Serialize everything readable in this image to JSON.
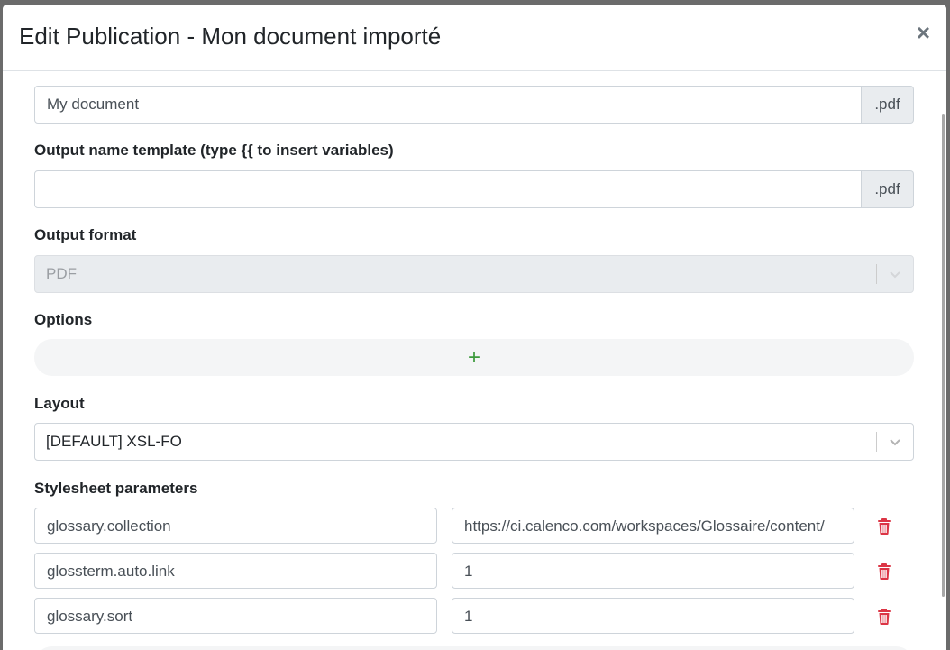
{
  "modal": {
    "title": "Edit Publication - Mon document importé",
    "close_label": "×"
  },
  "form": {
    "name_field": {
      "value": "My document",
      "suffix": ".pdf"
    },
    "output_template": {
      "label": "Output name template (type {{ to insert variables)",
      "value": "",
      "suffix": ".pdf"
    },
    "output_format": {
      "label": "Output format",
      "value": "PDF"
    },
    "options": {
      "label": "Options",
      "add_label": "+"
    },
    "layout": {
      "label": "Layout",
      "value": "[DEFAULT] XSL-FO"
    },
    "stylesheet_parameters": {
      "label": "Stylesheet parameters",
      "rows": [
        {
          "key": "glossary.collection",
          "value": "https://ci.calenco.com/workspaces/Glossaire/content/"
        },
        {
          "key": "glossterm.auto.link",
          "value": "1"
        },
        {
          "key": "glossary.sort",
          "value": "1"
        }
      ]
    }
  },
  "colors": {
    "accent_green": "#3d9a3d",
    "delete_red": "#dc3545"
  }
}
